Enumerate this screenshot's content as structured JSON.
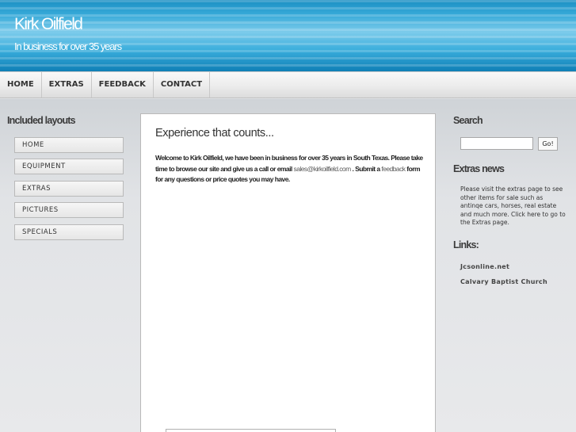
{
  "header": {
    "title": "Kirk Oilfield",
    "tagline": "In business for over 35 years"
  },
  "nav": {
    "items": [
      "HOME",
      "EXTRAS",
      "FEEDBACK",
      "CONTACT"
    ]
  },
  "left_sidebar": {
    "heading": "Included layouts",
    "items": [
      "HOME",
      "EQUIPMENT",
      "EXTRAS",
      "PICTURES",
      "SPECIALS"
    ]
  },
  "main": {
    "heading": "Experience that counts...",
    "text_part1": "Welcome to Kirk Oilfield, we have been in business for over 35 years in South Texas. Please take time to browse our site and give us a call or email ",
    "email": "sales@kirkoilfield.com",
    "text_part2": " . Submit a ",
    "feedback_link": "feedback",
    "text_part3": " form for any questions or price quotes you may have."
  },
  "right_sidebar": {
    "search_heading": "Search",
    "search_value": "",
    "search_button": "Go!",
    "news_heading": "Extras news",
    "news_text": "Please visit the extras page to see other items for sale such as antinqe cars, horses, real estate and much more. Click here to go to the Extras page.",
    "links_heading": "Links:",
    "links": [
      "Jcsonline.net",
      "Calvary Baptist Church"
    ]
  }
}
